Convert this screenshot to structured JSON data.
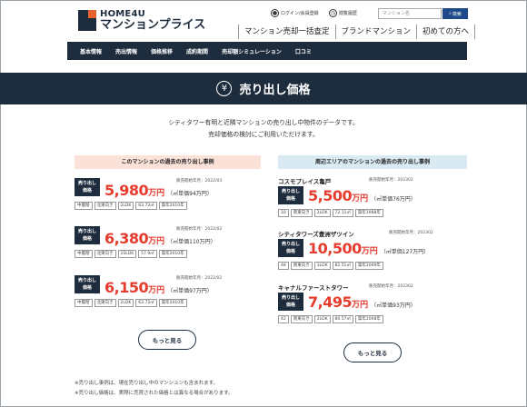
{
  "header": {
    "logo_top": "HOME4U",
    "logo_bottom": "マンションプライス",
    "login_label": "ログイン/会員登録",
    "history_label": "閲覧履歴",
    "search_placeholder": "マンション名",
    "search_button": "検索",
    "nav": [
      "マンション売却一括査定",
      "ブランドマンション",
      "初めての方へ"
    ]
  },
  "main_nav": [
    "基本情報",
    "売出情報",
    "価格推移",
    "成約期間",
    "売却額シミュレーション",
    "口コミ"
  ],
  "banner": {
    "icon": "yen-icon",
    "title": "売り出し価格"
  },
  "intro": [
    "シティタワー有明と近隣マンションの売り出し中物件のデータです。",
    "売却価格の検討にご利用いただけます。"
  ],
  "left_panel": {
    "title": "このマンションの過去の売り出し事例",
    "badge": [
      "売り出し",
      "価格"
    ],
    "listings": [
      {
        "date": "販売開始年月：2022/03",
        "price": "5,980",
        "unit": "万円",
        "unit_price": "（㎡単価94万円）",
        "tags": [
          "中層階",
          "北東向き",
          "2LDK",
          "63.72㎡",
          "築年2010年"
        ]
      },
      {
        "date": "販売開始年月：2022/02",
        "price": "6,380",
        "unit": "万円",
        "unit_price": "（㎡単価110万円）",
        "tags": [
          "中層階",
          "北東向き",
          "1SLDK",
          "57.9㎡",
          "築年2010年"
        ]
      },
      {
        "date": "販売開始年月：2022/02",
        "price": "6,150",
        "unit": "万円",
        "unit_price": "（㎡単価97万円）",
        "tags": [
          "中層階",
          "北東向き",
          "2LDK",
          "63.72㎡",
          "築年2010年"
        ]
      }
    ],
    "more_button": "もっと見る"
  },
  "right_panel": {
    "title": "周辺エリアのマンションの過去の売り出し事例",
    "badge": [
      "売り出し",
      "価格"
    ],
    "listings": [
      {
        "name": "コスモプレイス亀戸",
        "date": "販売開始年月：202302",
        "price": "5,500",
        "unit": "万円",
        "unit_price": "（㎡単価76万円）",
        "tags": [
          "10",
          "南東向き",
          "2LDK",
          "72.11㎡",
          "築年1988年"
        ]
      },
      {
        "name": "シティタワーズ豊洲ザツイン",
        "date": "販売開始年月：202302",
        "price": "10,500",
        "unit": "万円",
        "unit_price": "（㎡単価127万円）",
        "tags": [
          "48",
          "南東向き",
          "3LDK",
          "82.51㎡",
          "築年2009年"
        ]
      },
      {
        "name": "キャナルファーストタワー",
        "date": "販売開始年月：202302",
        "price": "7,495",
        "unit": "万円",
        "unit_price": "（㎡単価93万円）",
        "tags": [
          "42",
          "南東向き",
          "2LDK",
          "80.57㎡",
          "築年2008年"
        ]
      }
    ],
    "more_button": "もっと見る"
  },
  "notes": [
    "※売り出し事例は、現在売り出し中のマンションも含まれます。",
    "※売り出し価格は、実際に売買された価格とは異なる場合があります。"
  ],
  "colors": {
    "navy": "#1e2d3d",
    "price_red": "#e53c2e",
    "left_head_bg": "#fbe2d9",
    "right_head_bg": "#d9eaf3",
    "accent_orange": "#e8622b"
  }
}
